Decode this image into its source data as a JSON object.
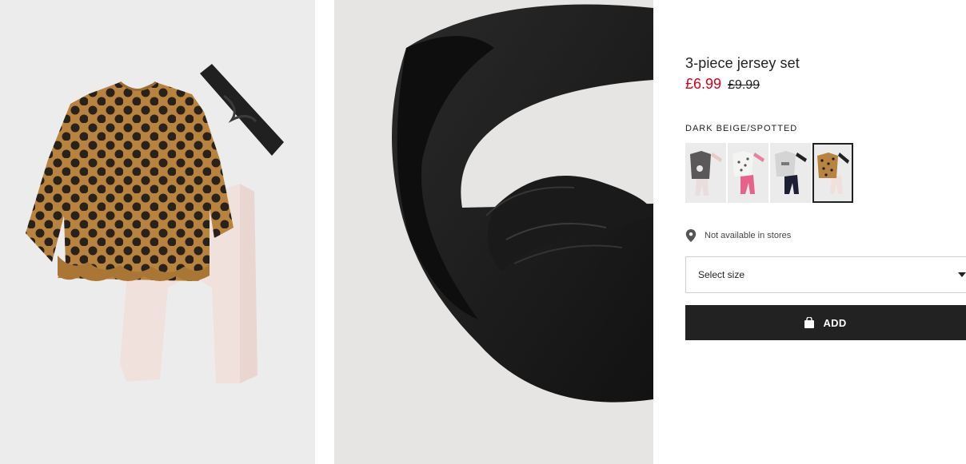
{
  "product": {
    "title": "3-piece jersey set",
    "price_sale": "£6.99",
    "price_original": "£9.99",
    "color_label": "DARK BEIGE/SPOTTED",
    "sale_color": "#d6001c"
  },
  "swatches": [
    {
      "icon": "grey-bunny-outfit-thumbnail",
      "selected": false
    },
    {
      "icon": "white-pink-outfit-thumbnail",
      "selected": false
    },
    {
      "icon": "grey-navy-outfit-thumbnail",
      "selected": false
    },
    {
      "icon": "beige-spotted-outfit-thumbnail",
      "selected": true
    }
  ],
  "availability": {
    "icon": "location-pin-icon",
    "text": "Not available in stores"
  },
  "size_select": {
    "label": "Select size",
    "icon": "chevron-down-icon"
  },
  "add_button": {
    "label": "ADD",
    "icon": "shopping-bag-icon"
  }
}
